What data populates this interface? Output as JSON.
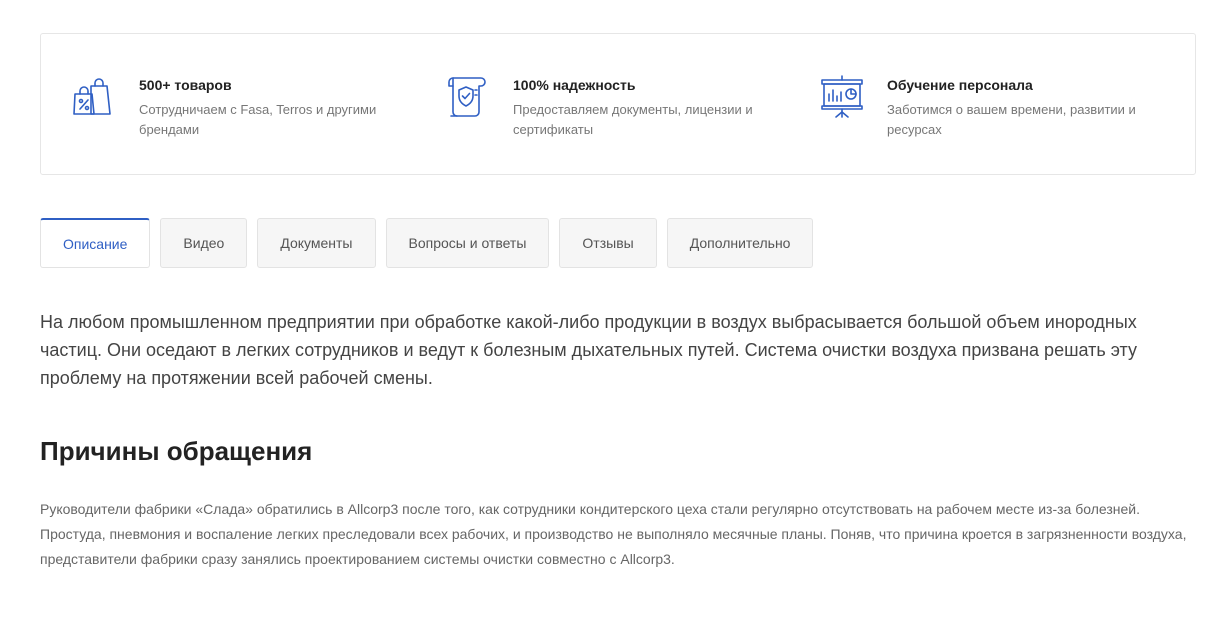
{
  "features": [
    {
      "icon": "shopping-bags-percent-icon",
      "title": "500+ товаров",
      "desc": "Сотрудничаем с Fasa, Terros и другими брендами"
    },
    {
      "icon": "certificate-shield-icon",
      "title": "100% надежность",
      "desc": "Предоставляем документы, лицензии и сертификаты"
    },
    {
      "icon": "presentation-board-icon",
      "title": "Обучение персонала",
      "desc": "Заботимся о вашем времени, развитии и ресурсах"
    }
  ],
  "tabs": [
    {
      "label": "Описание",
      "active": true
    },
    {
      "label": "Видео"
    },
    {
      "label": "Документы"
    },
    {
      "label": "Вопросы и ответы"
    },
    {
      "label": "Отзывы"
    },
    {
      "label": "Дополнительно"
    }
  ],
  "content": {
    "intro": "На любом промышленном предприятии при обработке какой-либо продукции в воздух выбрасывается большой объем инородных частиц. Они оседают в легких сотрудников и ведут к болезным дыхательных путей. Система очистки воздуха призвана решать эту проблему на протяжении всей рабочей смены.",
    "heading": "Причины обращения",
    "body": "Руководители фабрики «Слада» обратились в Allcorp3 после того, как сотрудники кондитерского цеха стали регулярно отсутствовать на рабочем месте из-за болезней. Простуда, пневмония и воспаление легких преследовали всех рабочих, и производство не выполняло месячные планы. Поняв, что причина кроется в загрязненности воздуха, представители фабрики сразу занялись проектированием системы очистки совместно с Allcorp3."
  },
  "colors": {
    "accent": "#2f5fc4",
    "icon": "#2f5fc4"
  }
}
